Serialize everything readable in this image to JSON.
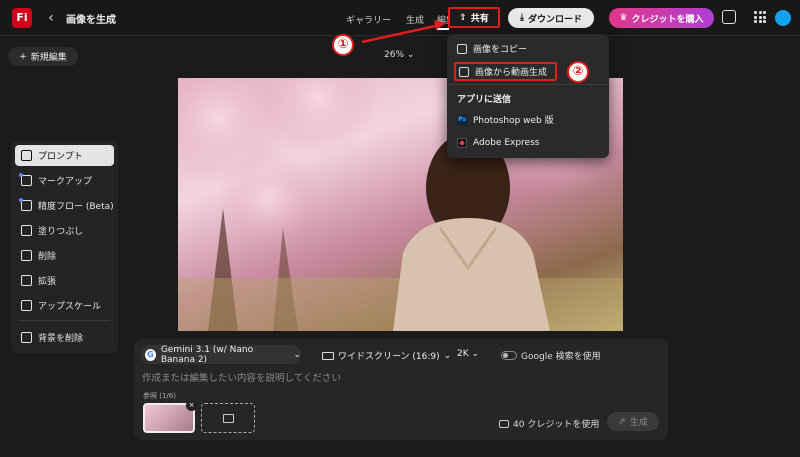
{
  "app": {
    "logo": "Fi",
    "page_title": "画像を生成"
  },
  "nav": {
    "gallery": "ギャラリー",
    "generate": "生成",
    "edit": "編集"
  },
  "header": {
    "share": "共有",
    "download": "ダウンロード",
    "buy_credits": "クレジットを購入"
  },
  "canvas": {
    "new_edit": "新規編集",
    "zoom": "26%"
  },
  "share_menu": {
    "copy_image": "画像をコピー",
    "image_to_video": "画像から動画生成",
    "send_to_app": "アプリに送信",
    "photoshop": "Photoshop web 版",
    "express": "Adobe Express"
  },
  "tools": [
    {
      "label": "プロンプト",
      "icon": "prompt-icon"
    },
    {
      "label": "マークアップ",
      "icon": "markup-icon"
    },
    {
      "label": "精度フロー (Beta)",
      "icon": "precision-flow-icon"
    },
    {
      "label": "塗りつぶし",
      "icon": "fill-icon"
    },
    {
      "label": "削除",
      "icon": "remove-icon"
    },
    {
      "label": "拡張",
      "icon": "expand-icon"
    },
    {
      "label": "アップスケール",
      "icon": "upscale-icon"
    },
    {
      "label": "背景を削除",
      "icon": "remove-background-icon"
    }
  ],
  "prompt_panel": {
    "model": "Gemini 3.1 (w/ Nano Banana 2)",
    "aspect": "ワイドスクリーン (16:9)",
    "resolution": "2K",
    "google_search": "Google 検索を使用",
    "placeholder": "作成または編集したい内容を説明してください",
    "reference_label": "参照 (1/6)",
    "credits": "40 クレジットを使用",
    "generate": "生成"
  },
  "annotations": {
    "one": "①",
    "two": "②"
  },
  "colors": {
    "annotation_red": "#e01e1e",
    "logo_red": "#d0021b",
    "accent_blue": "#5a8cff"
  }
}
